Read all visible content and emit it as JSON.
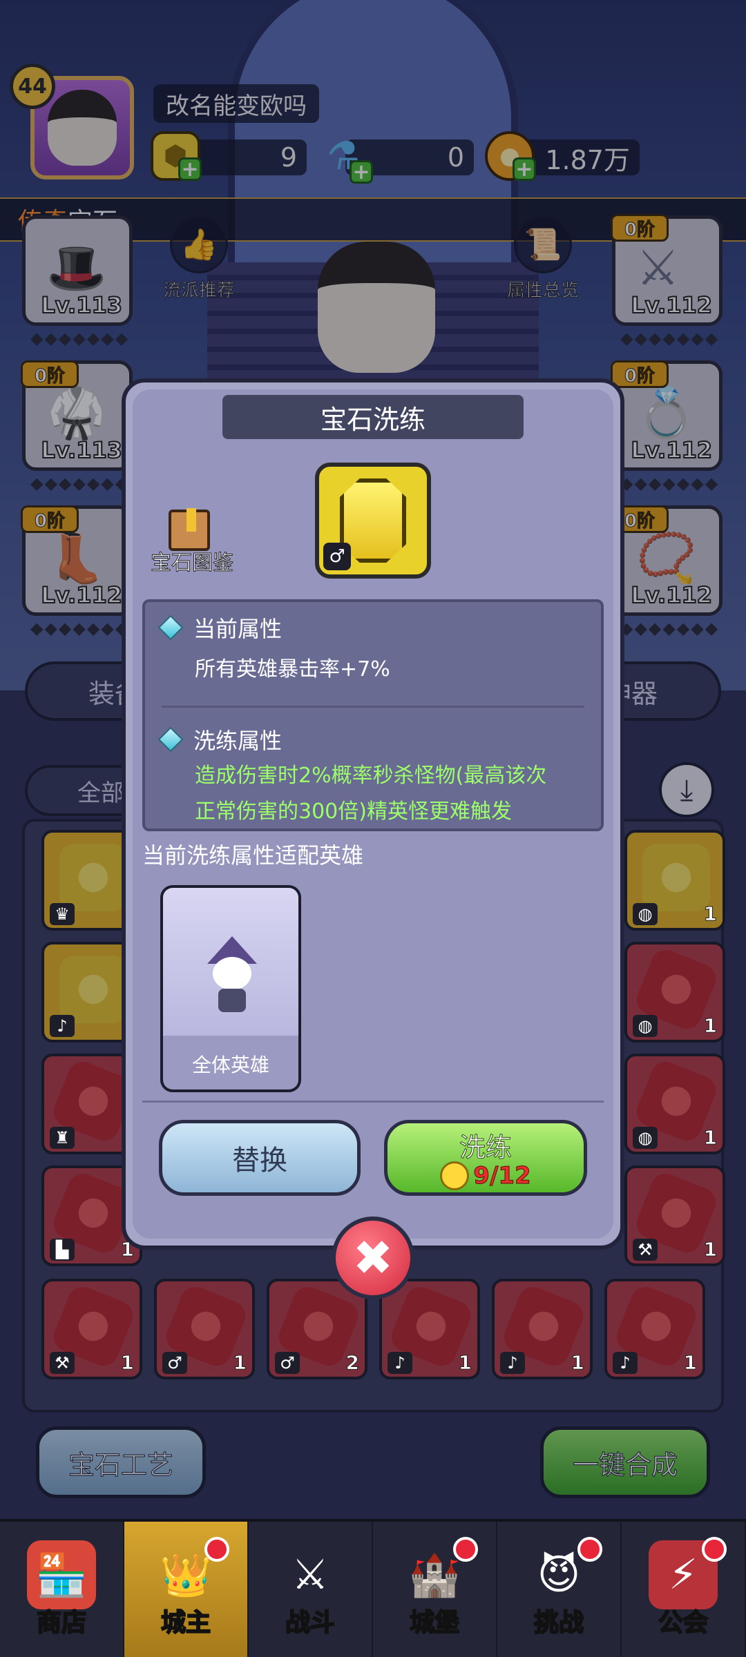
{
  "player": {
    "level": "44",
    "name": "改名能变欧吗"
  },
  "resources": {
    "gems": "9",
    "potion": "0",
    "gold": "1.87万"
  },
  "banner": {
    "prefix": "传奇",
    "suffix": "宝石"
  },
  "top_buttons": {
    "recommend": "流派推荐",
    "overview": "属性总览"
  },
  "equipment": {
    "left": [
      {
        "level": "Lv.113",
        "tier": ""
      },
      {
        "level": "Lv.113",
        "tier": "0阶"
      },
      {
        "level": "Lv.112",
        "tier": "0阶"
      }
    ],
    "right": [
      {
        "level": "Lv.112",
        "tier": "0阶"
      },
      {
        "level": "Lv.112",
        "tier": "0阶"
      },
      {
        "level": "Lv.112",
        "tier": "0阶"
      }
    ]
  },
  "tabs": {
    "equip": "装备",
    "artifact": "神器",
    "filter": "全部"
  },
  "grid": {
    "row5_counts": [
      "1",
      "1",
      "2",
      "1",
      "1",
      "1"
    ],
    "right_counts": [
      "1",
      "1",
      "1",
      "1"
    ],
    "left_partial_count": "1"
  },
  "bottom_buttons": {
    "craft": "宝石工艺",
    "merge": "一键合成"
  },
  "nav": {
    "items": [
      {
        "label": "商店",
        "icon": "shop-icon"
      },
      {
        "label": "城主",
        "icon": "crown-icon"
      },
      {
        "label": "战斗",
        "icon": "swords-icon"
      },
      {
        "label": "城堡",
        "icon": "castle-icon"
      },
      {
        "label": "挑战",
        "icon": "demon-icon"
      },
      {
        "label": "公会",
        "icon": "guild-icon"
      }
    ],
    "active_index": 1
  },
  "modal": {
    "title": "宝石洗练",
    "gem_codex": "宝石图鉴",
    "current_attr_title": "当前属性",
    "current_attr_value": "所有英雄暴击率+7%",
    "refine_attr_title": "洗练属性",
    "refine_attr_line1": "造成伤害时2%概率秒杀怪物(最高该次",
    "refine_attr_line2": "正常伤害的300倍)精英怪更难触发",
    "fit_hero_title": "当前洗练属性适配英雄",
    "hero_card_label": "全体英雄",
    "replace_button": "替换",
    "refine_button": "洗练",
    "refine_cost": "9/12"
  },
  "colors": {
    "accent_orange": "#ff8c2a",
    "refine_green": "#9cff6a",
    "cost_red": "#e8302a"
  }
}
